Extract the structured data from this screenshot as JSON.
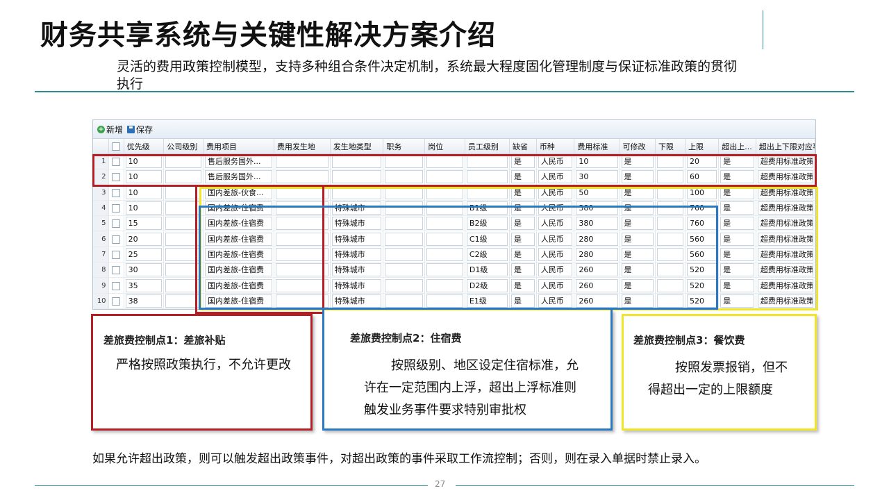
{
  "title": "财务共享系统与关键性解决方案介绍",
  "subtitle": "灵活的费用政策控制模型，支持多种组合条件决定机制，系统最大程度固化管理制度与保证标准政策的贯彻执行",
  "toolbar": {
    "add_label": "新增",
    "save_label": "保存"
  },
  "columns": [
    "",
    "",
    "优先级",
    "公司级别",
    "费用项目",
    "费用发生地",
    "发生地类型",
    "职务",
    "岗位",
    "员工级别",
    "缺省",
    "币种",
    "费用标准",
    "可修改",
    "下限",
    "上限",
    "超出上...",
    "超出上下限对应事件"
  ],
  "rows": [
    {
      "n": "1",
      "priority": "10",
      "company": "",
      "item": "售后服务国外...",
      "place": "",
      "place_type": "",
      "duty": "",
      "post": "",
      "level": "",
      "default": "是",
      "currency": "人民币",
      "standard": "10",
      "editable": "是",
      "lower": "",
      "upper": "20",
      "exceed": "是",
      "event": "超费用标准政策事件"
    },
    {
      "n": "2",
      "priority": "10",
      "company": "",
      "item": "售后服务国外...",
      "place": "",
      "place_type": "",
      "duty": "",
      "post": "",
      "level": "",
      "default": "是",
      "currency": "人民币",
      "standard": "30",
      "editable": "是",
      "lower": "",
      "upper": "60",
      "exceed": "是",
      "event": "超费用标准政策事件"
    },
    {
      "n": "3",
      "priority": "10",
      "company": "",
      "item": "国内差旅-伙食...",
      "place": "",
      "place_type": "",
      "duty": "",
      "post": "",
      "level": "",
      "default": "是",
      "currency": "人民币",
      "standard": "50",
      "editable": "是",
      "lower": "",
      "upper": "100",
      "exceed": "是",
      "event": "超费用标准政策事件"
    },
    {
      "n": "4",
      "priority": "10",
      "company": "",
      "item": "国内差旅-住宿费",
      "place": "",
      "place_type": "特殊城市",
      "duty": "",
      "post": "",
      "level": "B1级",
      "default": "是",
      "currency": "人民币",
      "standard": "380",
      "editable": "是",
      "lower": "",
      "upper": "760",
      "exceed": "是",
      "event": "超费用标准政策事件"
    },
    {
      "n": "5",
      "priority": "15",
      "company": "",
      "item": "国内差旅-住宿费",
      "place": "",
      "place_type": "特殊城市",
      "duty": "",
      "post": "",
      "level": "B2级",
      "default": "是",
      "currency": "人民币",
      "standard": "380",
      "editable": "是",
      "lower": "",
      "upper": "760",
      "exceed": "是",
      "event": "超费用标准政策事件"
    },
    {
      "n": "6",
      "priority": "20",
      "company": "",
      "item": "国内差旅-住宿费",
      "place": "",
      "place_type": "特殊城市",
      "duty": "",
      "post": "",
      "level": "C1级",
      "default": "是",
      "currency": "人民币",
      "standard": "280",
      "editable": "是",
      "lower": "",
      "upper": "560",
      "exceed": "是",
      "event": "超费用标准政策事件"
    },
    {
      "n": "7",
      "priority": "25",
      "company": "",
      "item": "国内差旅-住宿费",
      "place": "",
      "place_type": "特殊城市",
      "duty": "",
      "post": "",
      "level": "C2级",
      "default": "是",
      "currency": "人民币",
      "standard": "280",
      "editable": "是",
      "lower": "",
      "upper": "560",
      "exceed": "是",
      "event": "超费用标准政策事件"
    },
    {
      "n": "8",
      "priority": "30",
      "company": "",
      "item": "国内差旅-住宿费",
      "place": "",
      "place_type": "特殊城市",
      "duty": "",
      "post": "",
      "level": "D1级",
      "default": "是",
      "currency": "人民币",
      "standard": "260",
      "editable": "是",
      "lower": "",
      "upper": "520",
      "exceed": "是",
      "event": "超费用标准政策事件"
    },
    {
      "n": "9",
      "priority": "35",
      "company": "",
      "item": "国内差旅-住宿费",
      "place": "",
      "place_type": "特殊城市",
      "duty": "",
      "post": "",
      "level": "D2级",
      "default": "是",
      "currency": "人民币",
      "standard": "260",
      "editable": "是",
      "lower": "",
      "upper": "520",
      "exceed": "是",
      "event": "超费用标准政策事件"
    },
    {
      "n": "10",
      "priority": "38",
      "company": "",
      "item": "国内差旅-住宿费",
      "place": "",
      "place_type": "特殊城市",
      "duty": "",
      "post": "",
      "level": "E1级",
      "default": "是",
      "currency": "人民币",
      "standard": "260",
      "editable": "是",
      "lower": "",
      "upper": "520",
      "exceed": "是",
      "event": "超费用标准政策事件"
    }
  ],
  "callouts": {
    "red": {
      "title": "差旅费控制点1：差旅补贴",
      "lines": [
        "严格按照政策执行，不允许更改"
      ]
    },
    "blue": {
      "title": "差旅费控制点2：住宿费",
      "lines": [
        "按照级别、地区设定住宿标准，允",
        "许在一定范围内上浮，超出上浮标准则",
        "触发业务事件要求特别审批权"
      ]
    },
    "yellow": {
      "title": "差旅费控制点3：餐饮费",
      "lines": [
        "按照发票报销，但不",
        "得超出一定的上限额度"
      ]
    }
  },
  "footnote": "如果允许超出政策，则可以触发超出政策事件，对超出政策的事件采取工作流控制；否则，则在录入单据时禁止录入。",
  "page_number": "27",
  "colors": {
    "accent": "#2f8a94",
    "red": "#b41e24",
    "blue": "#2a77c2",
    "yellow": "#f0e52a"
  }
}
